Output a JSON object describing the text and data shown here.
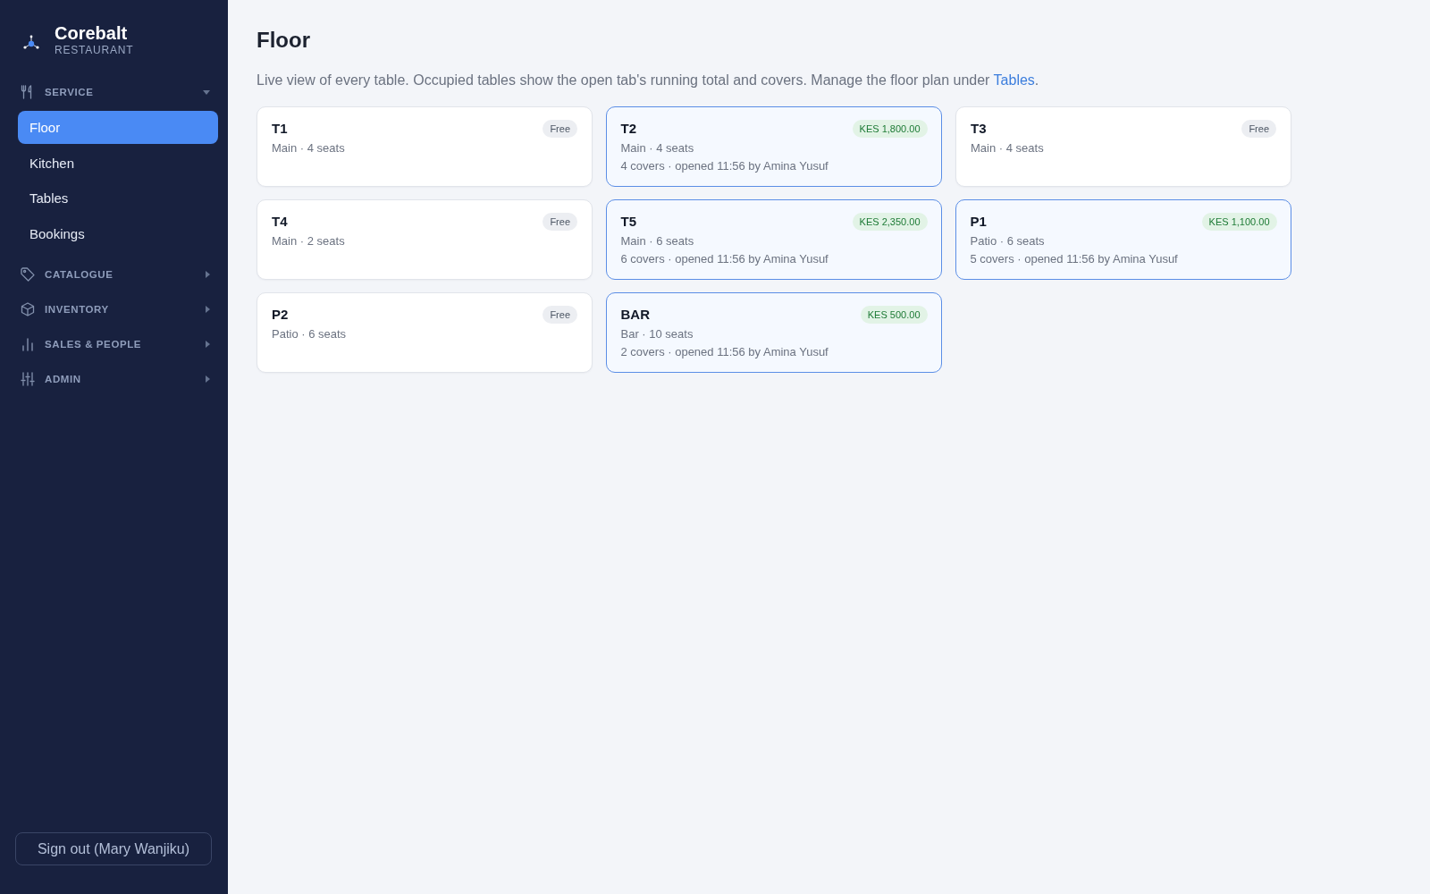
{
  "brand": {
    "name": "Corebalt",
    "subtitle": "RESTAURANT"
  },
  "sidebar": {
    "sections": [
      {
        "label": "SERVICE",
        "expanded": true,
        "items": [
          {
            "label": "Floor",
            "selected": true
          },
          {
            "label": "Kitchen",
            "selected": false
          },
          {
            "label": "Tables",
            "selected": false
          },
          {
            "label": "Bookings",
            "selected": false
          }
        ]
      },
      {
        "label": "CATALOGUE",
        "expanded": false
      },
      {
        "label": "INVENTORY",
        "expanded": false
      },
      {
        "label": "SALES & PEOPLE",
        "expanded": false
      },
      {
        "label": "ADMIN",
        "expanded": false
      }
    ],
    "sign_out": "Sign out (Mary Wanjiku)"
  },
  "page": {
    "title": "Floor",
    "description": "Live view of every table. Occupied tables show the open tab's running total and covers. Manage the floor plan under ",
    "link": "Tables",
    "description_end": "."
  },
  "tables": [
    {
      "name": "T1",
      "info": "Main · 4 seats",
      "occupied": false,
      "badge": "Free"
    },
    {
      "name": "T2",
      "info": "Main · 4 seats",
      "occupied": true,
      "badge": "KES 1,800.00",
      "details": "4 covers · opened 11:56 by Amina Yusuf"
    },
    {
      "name": "T3",
      "info": "Main · 4 seats",
      "occupied": false,
      "badge": "Free"
    },
    {
      "name": "T4",
      "info": "Main · 2 seats",
      "occupied": false,
      "badge": "Free"
    },
    {
      "name": "T5",
      "info": "Main · 6 seats",
      "occupied": true,
      "badge": "KES 2,350.00",
      "details": "6 covers · opened 11:56 by Amina Yusuf"
    },
    {
      "name": "P1",
      "info": "Patio · 6 seats",
      "occupied": true,
      "badge": "KES 1,100.00",
      "details": "5 covers · opened 11:56 by Amina Yusuf"
    },
    {
      "name": "P2",
      "info": "Patio · 6 seats",
      "occupied": false,
      "badge": "Free"
    },
    {
      "name": "BAR",
      "info": "Bar · 10 seats",
      "occupied": true,
      "badge": "KES 500.00",
      "details": "2 covers · opened 11:56 by Amina Yusuf"
    }
  ]
}
